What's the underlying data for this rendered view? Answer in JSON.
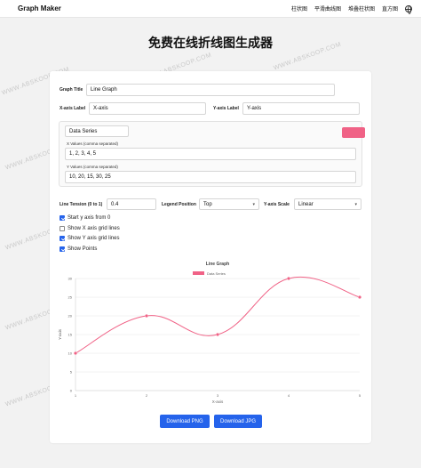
{
  "nav": {
    "brand": "Graph Maker",
    "links": [
      "柱状图",
      "平滑曲线图",
      "堆叠柱状图",
      "直方图"
    ],
    "globe_icon": "globe-icon"
  },
  "page_title": "免费在线折线图生成器",
  "form": {
    "graph_title_label": "Graph Title",
    "graph_title_value": "Line Graph",
    "x_axis_label_label": "X-axis Label",
    "x_axis_label_value": "X-axis",
    "y_axis_label_label": "Y-axis Label",
    "y_axis_label_value": "Y-axis",
    "series": {
      "name": "Data Series",
      "color": "#f06286",
      "x_label": "X Values (comma separated)",
      "x_value": "1, 2, 3, 4, 5",
      "y_label": "Y Values (comma separated)",
      "y_value": "10, 20, 15, 30, 25"
    },
    "tension_label": "Line Tension (0 to 1)",
    "tension_value": "0.4",
    "legend_label": "Legend Position",
    "legend_value": "Top",
    "scale_label": "Y-axis Scale",
    "scale_value": "Linear",
    "checkboxes": [
      {
        "label": "Start y axis from 0",
        "checked": true
      },
      {
        "label": "Show X axis grid lines",
        "checked": false
      },
      {
        "label": "Show Y axis grid lines",
        "checked": true
      },
      {
        "label": "Show Points",
        "checked": true
      }
    ]
  },
  "buttons": {
    "png": "Download PNG",
    "jpg": "Download JPG"
  },
  "watermark": "WWW.ABSKOOP.COM",
  "chart_data": {
    "type": "line",
    "title": "Line Graph",
    "xlabel": "X-axis",
    "ylabel": "Y-axis",
    "x": [
      1,
      2,
      3,
      4,
      5
    ],
    "series": [
      {
        "name": "Data Series",
        "values": [
          10,
          20,
          15,
          30,
          25
        ],
        "color": "#f06286"
      }
    ],
    "ylim": [
      0,
      30
    ],
    "yticks": [
      0,
      5,
      10,
      15,
      20,
      25,
      30
    ],
    "legend": "top",
    "x_grid": false,
    "y_grid": true,
    "tension": 0.4
  }
}
